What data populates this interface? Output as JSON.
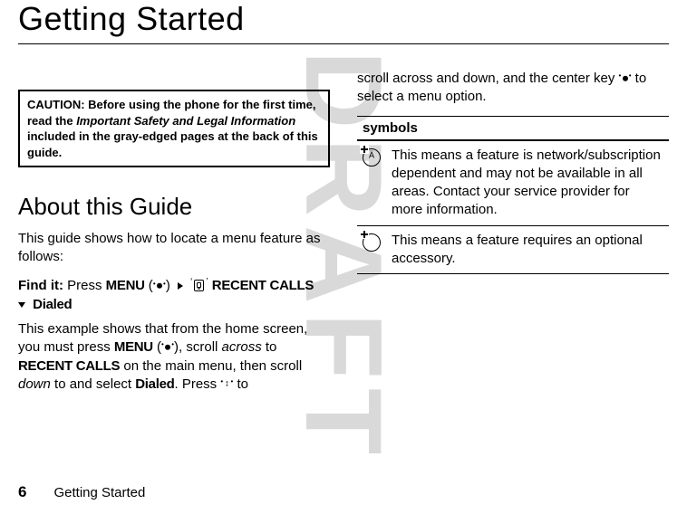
{
  "watermark": "DRAFT",
  "title": "Getting Started",
  "left": {
    "caution": {
      "label": "CAUTION:",
      "before": "Before using the phone for the first time, read the ",
      "italic": "Important Safety and Legal Information",
      "after": " included in the gray-edged pages at the back of this guide."
    },
    "about_heading": "About this Guide",
    "intro": "This guide shows how to locate a menu feature as follows:",
    "find_it_label": "Find it:",
    "press_word": "Press",
    "menu_label": "MENU",
    "recent_calls_label": "RECENT CALLS",
    "dialed_label": "Dialed",
    "para2_a": "This example shows that from the home screen, you must press ",
    "para2_menu": "MENU",
    "para2_b": ", scroll ",
    "para2_across": "across",
    "para2_c": " to ",
    "para2_recent": "RECENT CALLS",
    "para2_d": " on the main menu, then scroll ",
    "para2_down": "down",
    "para2_e": " to and select ",
    "para2_dialed": "Dialed",
    "para2_f": ". Press ",
    "para2_g": " to"
  },
  "right": {
    "continue_a": "scroll across and down, and the center key ",
    "continue_b": " to select a menu option.",
    "symbols_header": "symbols",
    "row1": "This means a feature is network/subscription dependent and may not be available in all areas. Contact your service provider for more information.",
    "row2": "This means a feature requires an optional accessory."
  },
  "footer": {
    "page_number": "6",
    "section": "Getting Started"
  }
}
